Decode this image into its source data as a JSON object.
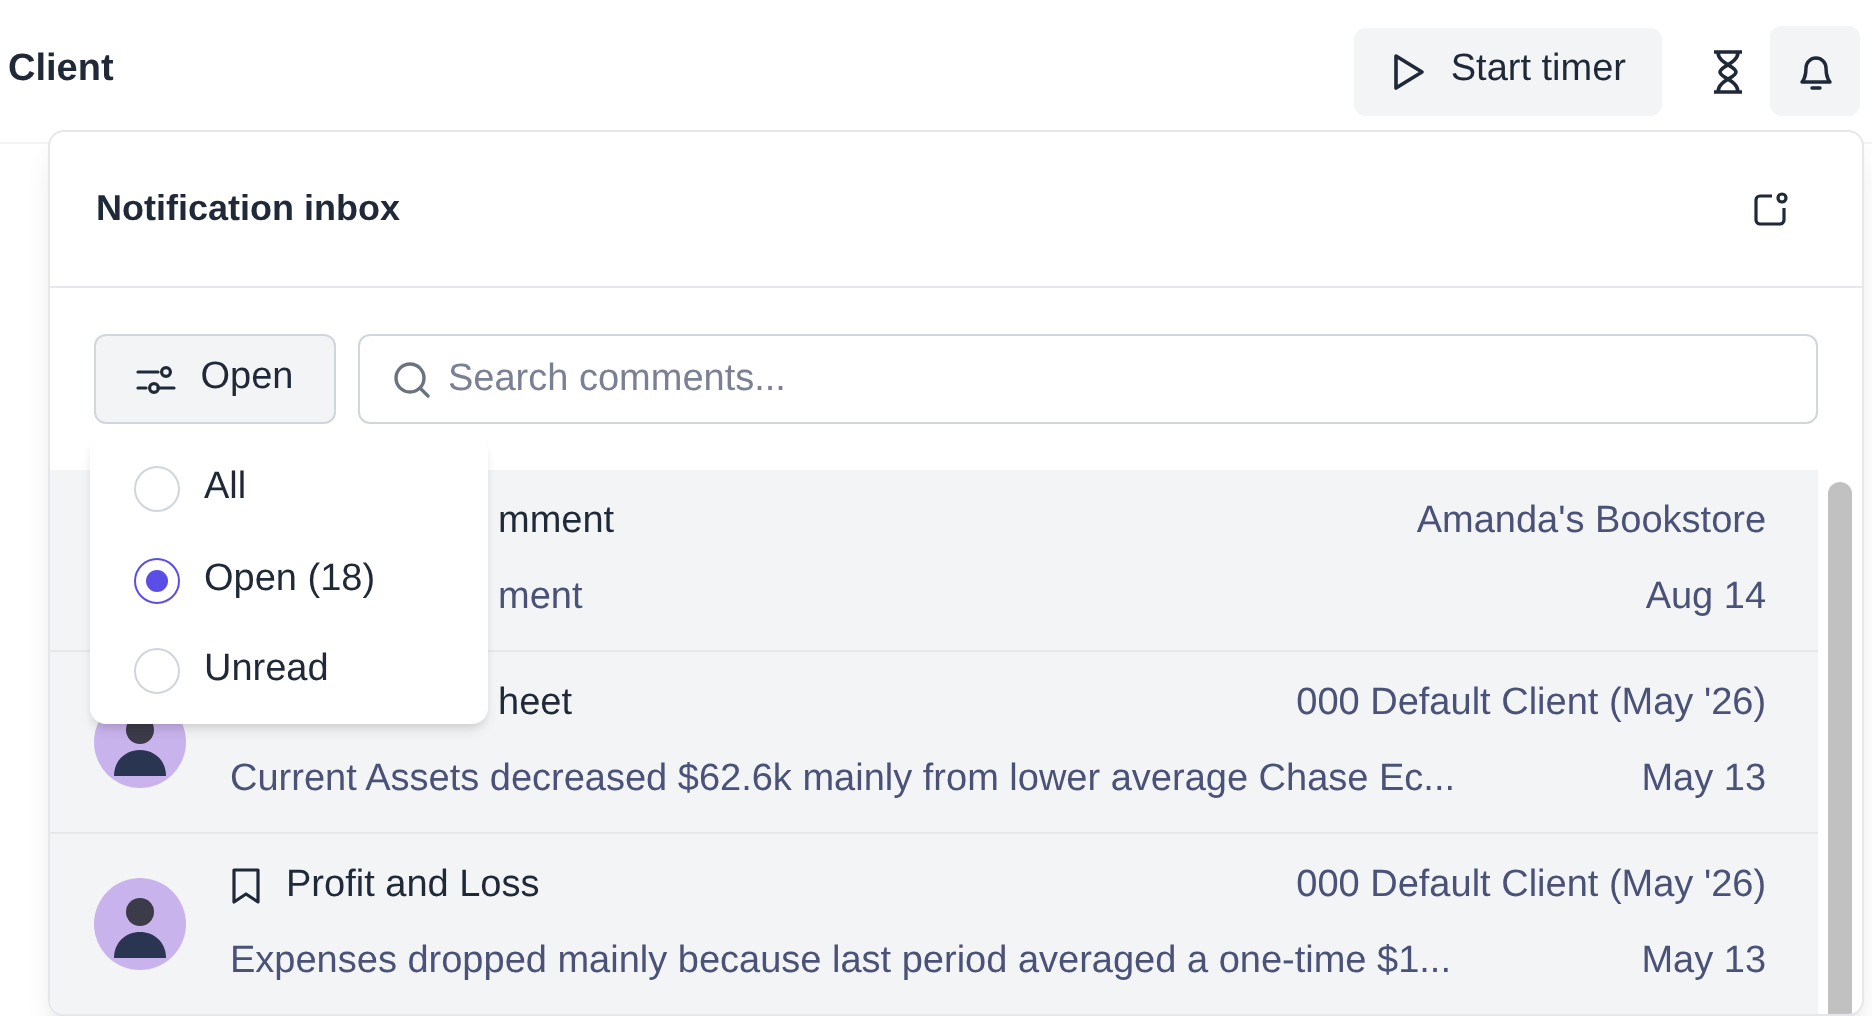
{
  "header": {
    "title": "Client",
    "start_timer": "Start timer"
  },
  "inbox": {
    "title": "Notification inbox",
    "filter_button": "Open",
    "search": {
      "placeholder": "Search comments..."
    },
    "items": [
      {
        "title": "mment",
        "client": "Amanda's Bookstore",
        "preview": "ment",
        "date": "Aug 14",
        "kind": "hidden"
      },
      {
        "title": "heet",
        "client": "000 Default Client (May '26)",
        "preview": "Current Assets decreased $62.6k mainly from lower average Chase Ec...",
        "date": "May 13",
        "kind": "partial"
      },
      {
        "title": "Profit and Loss",
        "client": "000 Default Client (May '26)",
        "preview": "Expenses dropped mainly because last period averaged a one-time $1...",
        "date": "May 13",
        "kind": "plain"
      }
    ]
  },
  "filter_menu": [
    {
      "label": "All",
      "selected": false
    },
    {
      "label": "Open (18)",
      "selected": true
    },
    {
      "label": "Unread",
      "selected": false
    }
  ]
}
